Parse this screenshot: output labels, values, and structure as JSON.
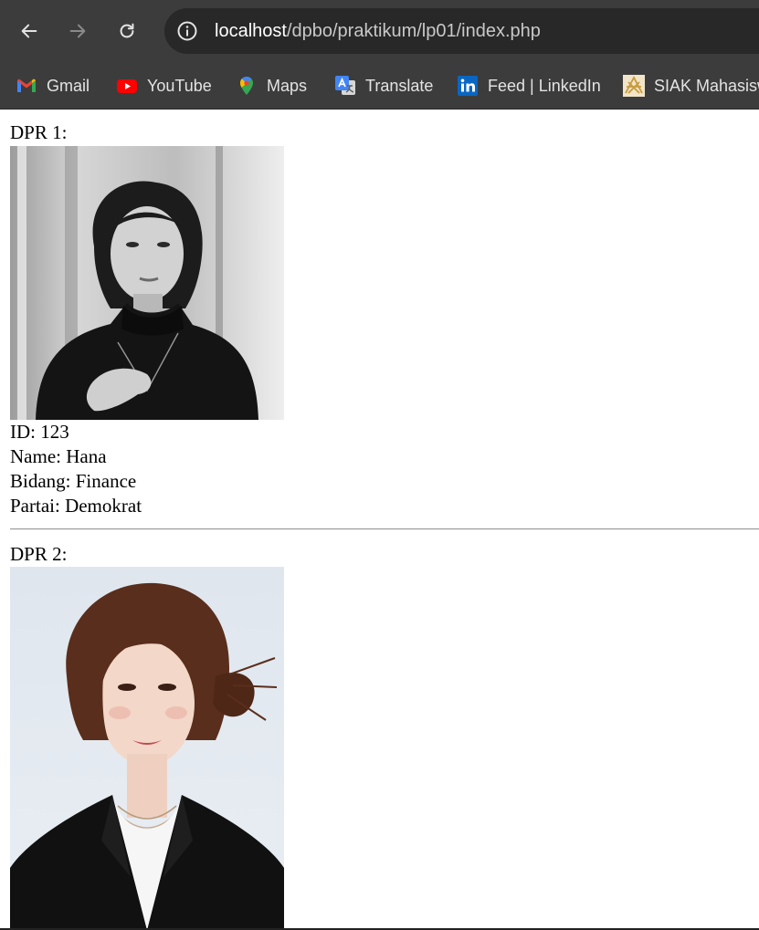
{
  "browser": {
    "url_host": "localhost",
    "url_path": "/dpbo/praktikum/lp01/index.php",
    "bookmarks": [
      {
        "label": "Gmail",
        "icon": "gmail-icon"
      },
      {
        "label": "YouTube",
        "icon": "youtube-icon"
      },
      {
        "label": "Maps",
        "icon": "maps-icon"
      },
      {
        "label": "Translate",
        "icon": "translate-icon"
      },
      {
        "label": "Feed | LinkedIn",
        "icon": "linkedin-icon"
      },
      {
        "label": "SIAK Mahasisw",
        "icon": "siak-icon"
      }
    ]
  },
  "colors": {
    "chrome_bg": "#3c3c3c",
    "omnibox_bg": "#282828",
    "page_bg": "#ffffff"
  },
  "records": [
    {
      "heading": "DPR 1:",
      "id_line": "ID: 123",
      "name_line": "Name: Hana",
      "bidang_line": "Bidang: Finance",
      "partai_line": "Partai: Demokrat"
    },
    {
      "heading": "DPR 2:"
    }
  ]
}
